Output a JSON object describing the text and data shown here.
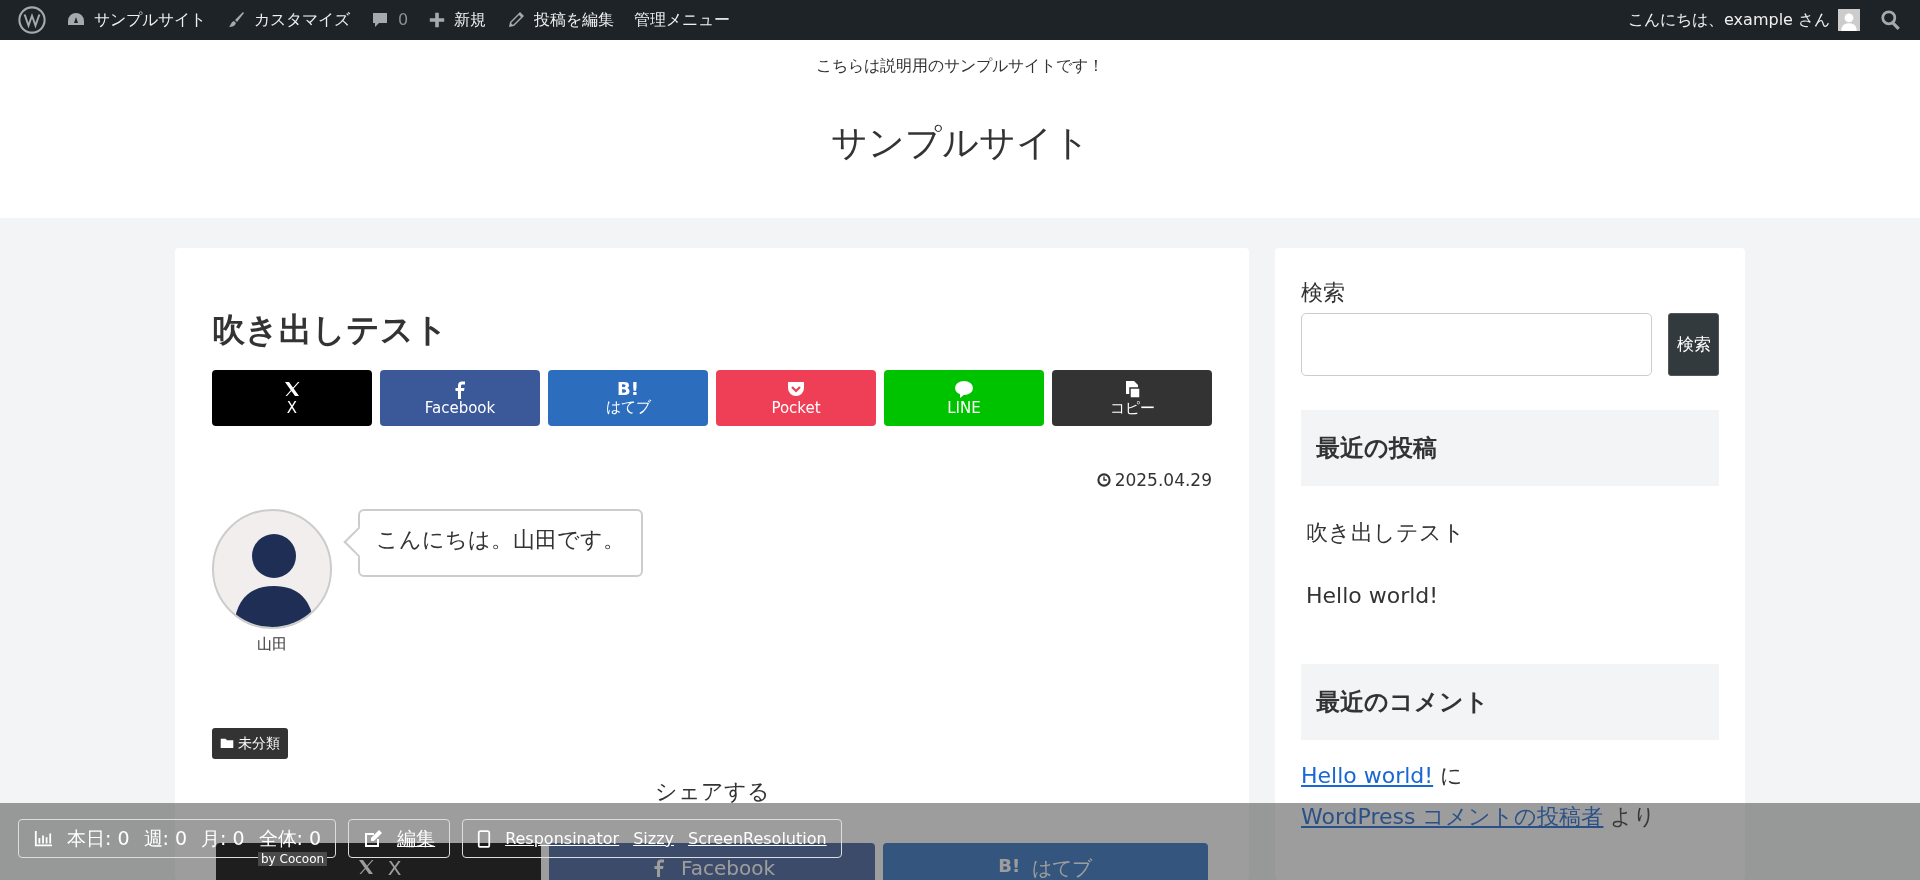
{
  "admin_bar": {
    "items": [
      {
        "kind": "logo"
      },
      {
        "kind": "dashboard",
        "label": "サンプルサイト"
      },
      {
        "kind": "brush",
        "label": "カスタマイズ"
      },
      {
        "kind": "comment",
        "label": "0"
      },
      {
        "kind": "plus",
        "label": "新規"
      },
      {
        "kind": "pencil",
        "label": "投稿を編集"
      },
      {
        "kind": "text",
        "label": "管理メニュー"
      }
    ],
    "greeting": "こんにちは、example さん"
  },
  "header": {
    "tagline": "こちらは説明用のサンプルサイトです！",
    "site_title": "サンプルサイト"
  },
  "article": {
    "title": "吹き出しテスト",
    "share_top": [
      {
        "kind": "x",
        "label": "X",
        "color": "#000000"
      },
      {
        "kind": "facebook",
        "label": "Facebook",
        "color": "#3b5998"
      },
      {
        "kind": "hatebu",
        "glyph": "B!",
        "label": "はてブ",
        "color": "#2c6ebd"
      },
      {
        "kind": "pocket",
        "label": "Pocket",
        "color": "#ef3f56"
      },
      {
        "kind": "line",
        "label": "LINE",
        "color": "#00c300"
      },
      {
        "kind": "copy",
        "label": "コピー",
        "color": "#333333"
      }
    ],
    "date": "2025.04.29",
    "balloon": {
      "speaker": "山田",
      "text": "こんにちは。山田です。"
    },
    "category": "未分類",
    "share_bottom": {
      "heading": "シェアする",
      "buttons": [
        {
          "kind": "x",
          "label": "X",
          "color": "#1e1e1e"
        },
        {
          "kind": "facebook",
          "label": "Facebook",
          "color": "#3c4b6a"
        },
        {
          "kind": "hatebu",
          "glyph": "B!",
          "label": "はてブ",
          "color": "#34557d"
        }
      ]
    }
  },
  "sidebar": {
    "search": {
      "label": "検索",
      "button": "検索"
    },
    "recent_posts": {
      "title": "最近の投稿",
      "items": [
        "吹き出しテスト",
        "Hello world!"
      ]
    },
    "recent_comments": {
      "title": "最近のコメント",
      "comment": [
        {
          "kind": "link",
          "text": "Hello world!"
        },
        {
          "kind": "text",
          "text": "に"
        },
        {
          "kind": "link",
          "text": "WordPress コメントの投稿者"
        },
        {
          "kind": "text",
          "text": "より"
        }
      ]
    }
  },
  "footer_bar": {
    "counts": [
      "本日: 0",
      "週: 0",
      "月: 0",
      "全体: 0"
    ],
    "by": "by Cocoon",
    "edit": "編集",
    "tools": [
      "Responsinator",
      "Sizzy",
      "ScreenResolution"
    ]
  }
}
